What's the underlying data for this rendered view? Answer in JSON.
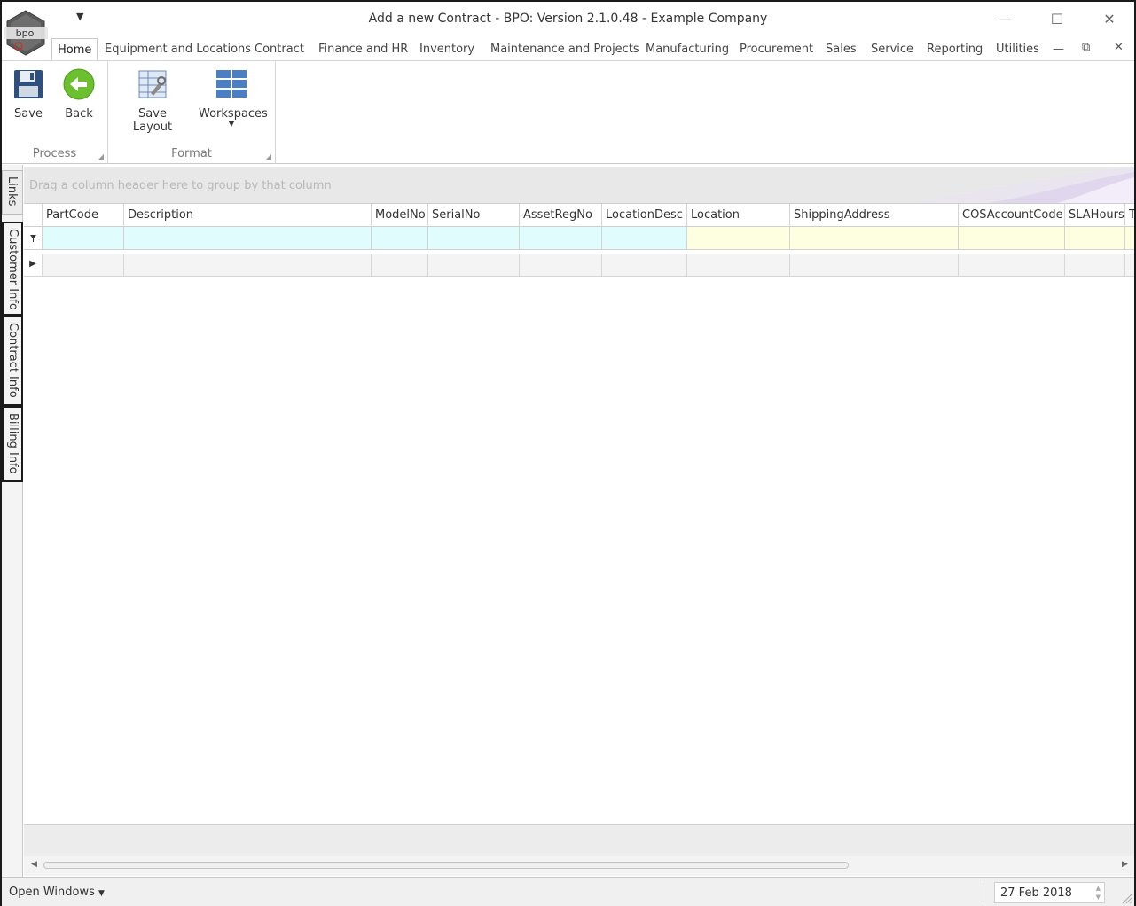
{
  "window": {
    "title": "Add a new Contract - BPO: Version 2.1.0.48 - Example Company",
    "logo_text": "bpo",
    "qat_icon": "quick-access-dropdown-icon"
  },
  "ribbon_tabs": [
    {
      "label": "Home",
      "active": true
    },
    {
      "label": "Equipment and Locations"
    },
    {
      "label": "Contract"
    },
    {
      "label": "Finance and HR"
    },
    {
      "label": "Inventory"
    },
    {
      "label": "Maintenance and Projects"
    },
    {
      "label": "Manufacturing"
    },
    {
      "label": "Procurement"
    },
    {
      "label": "Sales"
    },
    {
      "label": "Service"
    },
    {
      "label": "Reporting"
    },
    {
      "label": "Utilities"
    }
  ],
  "ribbon": {
    "groups": [
      {
        "caption": "Process",
        "buttons": [
          {
            "label": "Save",
            "icon": "floppy-disk-icon"
          },
          {
            "label": "Back",
            "icon": "back-arrow-icon"
          }
        ]
      },
      {
        "caption": "Format",
        "buttons": [
          {
            "label": "Save Layout",
            "icon": "save-layout-icon"
          },
          {
            "label": "Workspaces",
            "icon": "workspaces-icon"
          }
        ]
      }
    ]
  },
  "side_tabs": [
    "Links",
    "Customer Info",
    "Contract Info",
    "Billing Info"
  ],
  "grid": {
    "group_hint": "Drag a column header here to group by that column",
    "columns": [
      "PartCode",
      "Description",
      "ModelNo",
      "SerialNo",
      "AssetRegNo",
      "LocationDesc",
      "Location",
      "ShippingAddress",
      "COSAccountCode",
      "SLAHours",
      "T"
    ],
    "colors": {
      "filter_cyan": "#e0fcfc",
      "filter_yellow": "#fefee0"
    }
  },
  "status": {
    "open_windows": "Open Windows",
    "date": "27 Feb 2018"
  }
}
